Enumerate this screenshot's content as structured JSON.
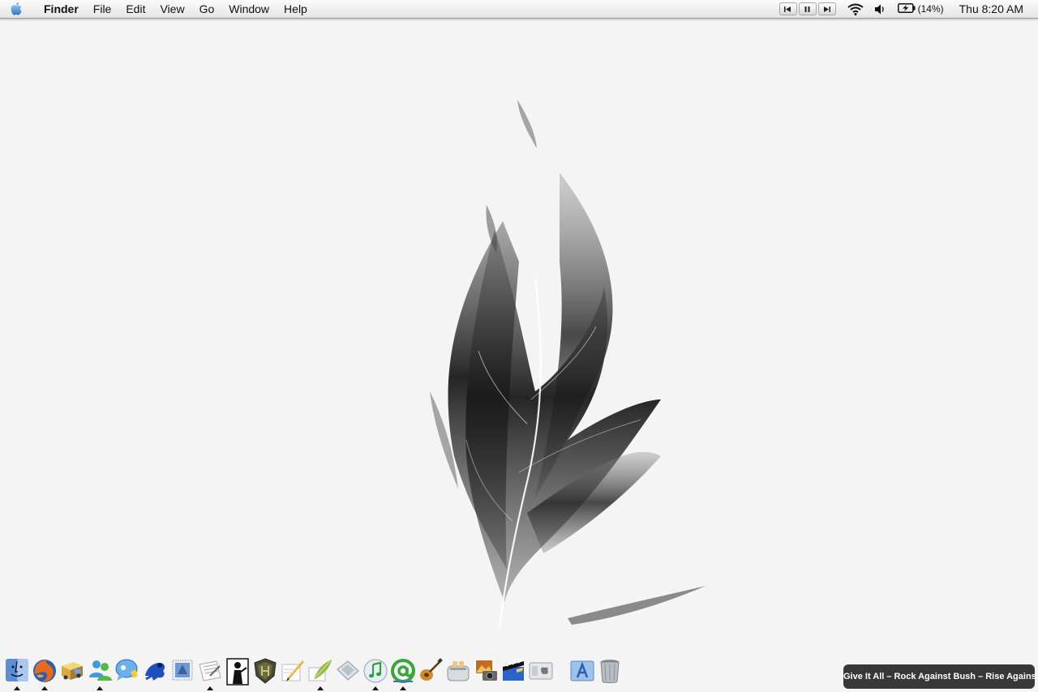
{
  "menubar": {
    "apple_icon": "apple-logo-icon",
    "app_name": "Finder",
    "menus": [
      "File",
      "Edit",
      "View",
      "Go",
      "Window",
      "Help"
    ],
    "media_controls": [
      "previous-track-icon",
      "pause-icon",
      "next-track-icon"
    ],
    "wifi_icon": "wifi-icon",
    "volume_icon": "volume-icon",
    "battery_icon": "battery-charging-icon",
    "battery_percent": "(14%)",
    "clock": "Thu 8:20 AM"
  },
  "desktop": {
    "wallpaper": "feather-wallpaper",
    "background_color": "#f4f4f4"
  },
  "dock": {
    "items": [
      {
        "name": "finder",
        "icon": "finder-icon",
        "running": true
      },
      {
        "name": "firefox",
        "icon": "firefox-icon",
        "running": true
      },
      {
        "name": "transmit",
        "icon": "delivery-truck-icon",
        "running": false
      },
      {
        "name": "messenger",
        "icon": "messenger-buddy-icon",
        "running": true
      },
      {
        "name": "ichat",
        "icon": "chat-bubble-icon",
        "running": false
      },
      {
        "name": "frogblast",
        "icon": "blue-frog-icon",
        "running": false
      },
      {
        "name": "mail",
        "icon": "mail-stamp-icon",
        "running": false
      },
      {
        "name": "textedit",
        "icon": "text-document-icon",
        "running": true
      },
      {
        "name": "max-payne",
        "icon": "game-figure-icon",
        "running": false
      },
      {
        "name": "halo",
        "icon": "shield-emblem-icon",
        "running": false
      },
      {
        "name": "pages",
        "icon": "pen-paper-icon",
        "running": false
      },
      {
        "name": "feather-app",
        "icon": "quill-icon",
        "running": true
      },
      {
        "name": "preview",
        "icon": "glass-slide-icon",
        "running": false
      },
      {
        "name": "itunes",
        "icon": "itunes-note-icon",
        "running": true
      },
      {
        "name": "adium",
        "icon": "green-at-sign-icon",
        "running": true
      },
      {
        "name": "garageband",
        "icon": "guitar-icon",
        "running": false
      },
      {
        "name": "toast",
        "icon": "toaster-icon",
        "running": false
      },
      {
        "name": "iphoto",
        "icon": "photo-camera-icon",
        "running": false
      },
      {
        "name": "imovie",
        "icon": "clapperboard-icon",
        "running": false
      },
      {
        "name": "system-preferences",
        "icon": "apple-panel-icon",
        "running": false
      },
      {
        "name": "applications",
        "icon": "applications-folder-icon",
        "running": false
      },
      {
        "name": "trash",
        "icon": "trash-can-icon",
        "running": false
      }
    ]
  },
  "now_playing": {
    "text": "Give It All – Rock Against Bush – Rise Against"
  }
}
